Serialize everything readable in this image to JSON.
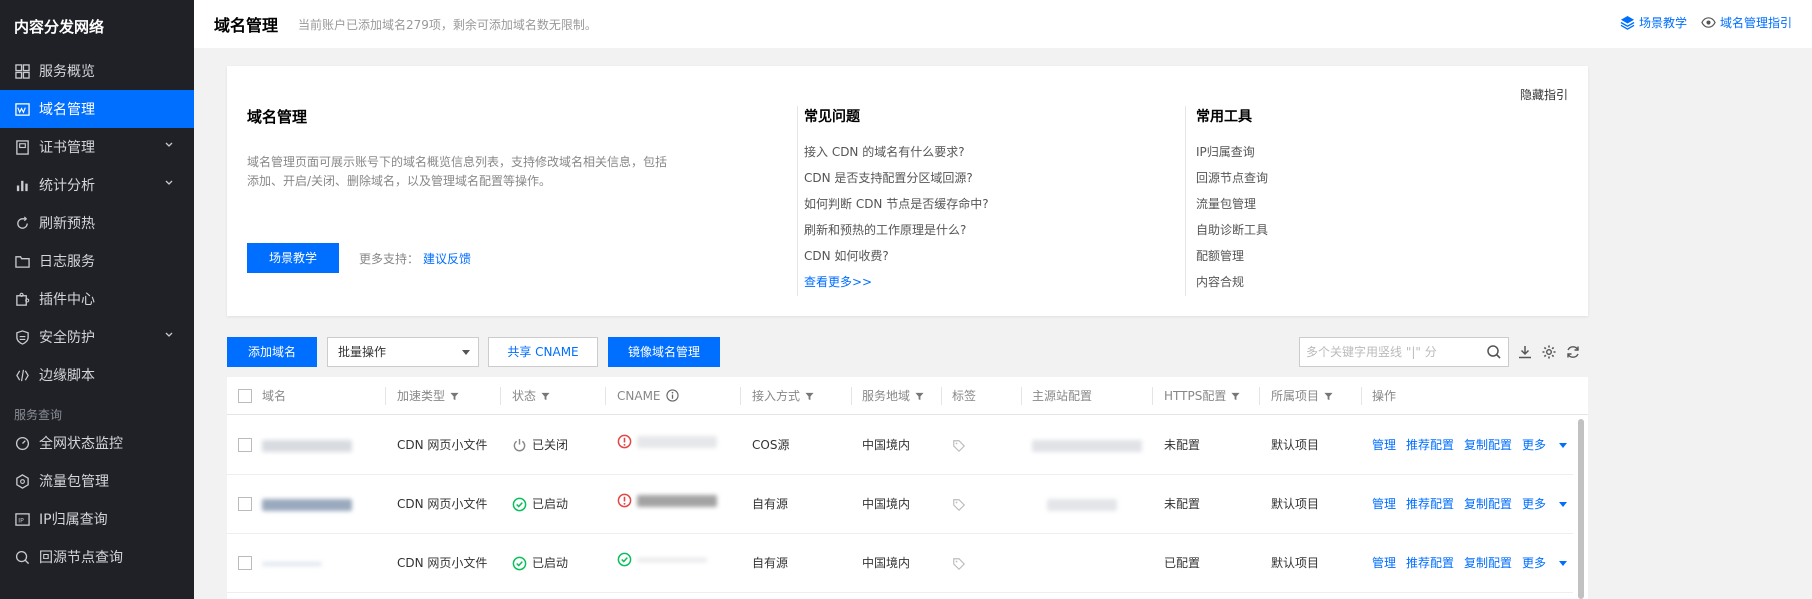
{
  "sidebar": {
    "brand": "内容分发网络",
    "items": [
      {
        "label": "服务概览",
        "icon": "grid-icon"
      },
      {
        "label": "域名管理",
        "icon": "domain-icon",
        "active": true
      },
      {
        "label": "证书管理",
        "icon": "certificate-icon",
        "expandable": true
      },
      {
        "label": "统计分析",
        "icon": "bar-chart-icon",
        "expandable": true
      },
      {
        "label": "刷新预热",
        "icon": "refresh-icon"
      },
      {
        "label": "日志服务",
        "icon": "folder-icon"
      },
      {
        "label": "插件中心",
        "icon": "plugin-icon"
      },
      {
        "label": "安全防护",
        "icon": "shield-icon",
        "expandable": true
      },
      {
        "label": "边缘脚本",
        "icon": "code-icon"
      }
    ],
    "section_label": "服务查询",
    "query_items": [
      {
        "label": "全网状态监控",
        "icon": "gauge-icon"
      },
      {
        "label": "流量包管理",
        "icon": "package-icon"
      },
      {
        "label": "IP归属查询",
        "icon": "ip-icon"
      },
      {
        "label": "回源节点查询",
        "icon": "search-node-icon"
      }
    ]
  },
  "header": {
    "title": "域名管理",
    "subtitle": "当前账户已添加域名279项，剩余可添加域名数无限制。",
    "link_tutorial": "场景教学",
    "link_guide": "域名管理指引"
  },
  "guide": {
    "hide_label": "隐藏指引",
    "title": "域名管理",
    "description": "域名管理页面可展示账号下的域名概览信息列表，支持修改域名相关信息，包括添加、开启/关闭、删除域名，以及管理域名配置等操作。",
    "cta_label": "场景教学",
    "more_support_label": "更多支持：",
    "feedback_label": "建议反馈",
    "faq_title": "常见问题",
    "faq": [
      "接入 CDN 的域名有什么要求?",
      "CDN 是否支持配置分区域回源?",
      "如何判断 CDN 节点是否缓存命中?",
      "刷新和预热的工作原理是什么?",
      "CDN 如何收费?"
    ],
    "see_more": "查看更多>>",
    "tools_title": "常用工具",
    "tools": [
      "IP归属查询",
      "回源节点查询",
      "流量包管理",
      "自助诊断工具",
      "配额管理",
      "内容合规"
    ]
  },
  "toolbar": {
    "add_domain": "添加域名",
    "batch_select": "批量操作",
    "share_cname": "共享 CNAME",
    "mirror_domain": "镜像域名管理",
    "search_placeholder": "多个关键字用竖线 \"|\" 分"
  },
  "table": {
    "columns": {
      "domain": "域名",
      "accel_type": "加速类型",
      "status": "状态",
      "cname": "CNAME",
      "access_mode": "接入方式",
      "service_region": "服务地域",
      "tags": "标签",
      "origin_config": "主源站配置",
      "https_config": "HTTPS配置",
      "project": "所属项目",
      "actions": "操作"
    },
    "rows": [
      {
        "accel_type": "CDN 网页小文件",
        "status": "已关闭",
        "status_kind": "off",
        "cname_status": "error",
        "access_mode": "COS源",
        "region": "中国境内",
        "https": "未配置",
        "project": "默认项目"
      },
      {
        "accel_type": "CDN 网页小文件",
        "status": "已启动",
        "status_kind": "on",
        "cname_status": "error",
        "access_mode": "自有源",
        "region": "中国境内",
        "https": "未配置",
        "project": "默认项目"
      },
      {
        "accel_type": "CDN 网页小文件",
        "status": "已启动",
        "status_kind": "on",
        "cname_status": "ok",
        "access_mode": "自有源",
        "region": "中国境内",
        "https": "已配置",
        "project": "默认项目"
      }
    ],
    "actions": {
      "manage": "管理",
      "recommend": "推荐配置",
      "copy": "复制配置",
      "more": "更多"
    }
  },
  "colors": {
    "accent": "#006eff",
    "sidebar_bg": "#1f2126",
    "success": "#0abf5b",
    "error": "#e54545"
  }
}
